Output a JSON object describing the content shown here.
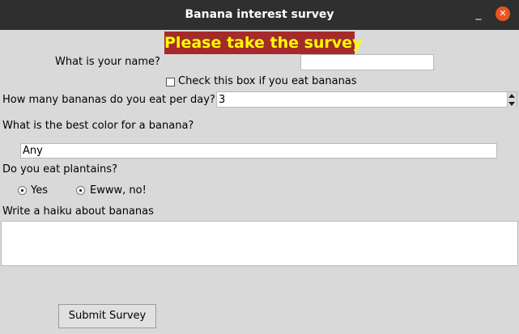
{
  "window": {
    "title": "Banana interest survey",
    "minimize_glyph": "_",
    "close_glyph": "✕",
    "close_color": "#e95420"
  },
  "form": {
    "heading": "Please take the survey",
    "heading_bg": "#a52a2a",
    "heading_fg": "#ffff00",
    "name_label": "What is your name?",
    "name_value": "",
    "eat_bananas_label": "Check this box if you eat bananas",
    "eat_bananas_checked": false,
    "count_label": "How many bananas do you eat per day?",
    "count_value": "3",
    "color_label": "What is the best color for a banana?",
    "color_value": "Any",
    "plantains_label": "Do you eat plantains?",
    "plantains_options": [
      "Yes",
      "Ewww, no!"
    ],
    "haiku_label": "Write a haiku about bananas",
    "haiku_value": "",
    "submit_label": "Submit Survey"
  }
}
